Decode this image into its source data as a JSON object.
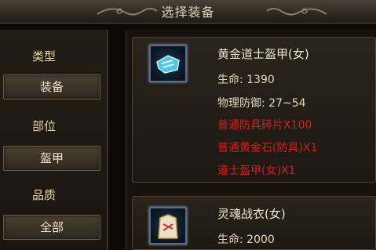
{
  "header": {
    "title": "选择装备"
  },
  "filters": {
    "type_label": "类型",
    "type_value": "装备",
    "slot_label": "部位",
    "slot_value": "盔甲",
    "quality_label": "品质",
    "quality_value": "全部"
  },
  "items": [
    {
      "name": "黄金道士盔甲(女)",
      "hp": "生命: 1390",
      "defense": "物理防御: 27~54",
      "requirements": [
        "普通防具碎片X100",
        "普通黄金石(防具)X1",
        "道士盔甲(女)X1"
      ],
      "icon": "armor-item-icon"
    },
    {
      "name": "灵魂战衣(女)",
      "hp": "生命: 2000",
      "icon": "robe-item-icon"
    }
  ],
  "colors": {
    "requirement": "#d41e1e",
    "frame": "#4e4333",
    "background": "#17120d"
  }
}
